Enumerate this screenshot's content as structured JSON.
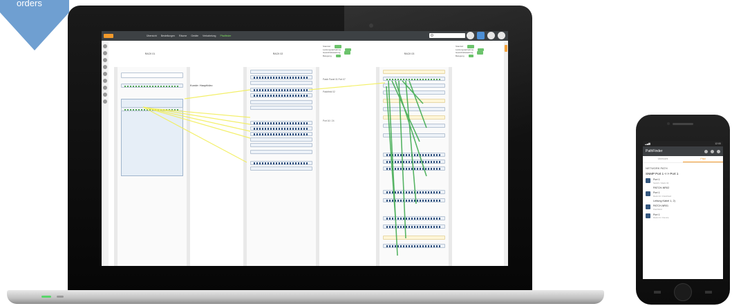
{
  "badge": {
    "label": "orders",
    "color": "#6f9fd1"
  },
  "app": {
    "menu": [
      "Übersicht",
      "Bestellungen",
      "Räume",
      "Geräte",
      "Verkabelung",
      "Pfadfinder"
    ],
    "search_placeholder": "Suchen",
    "racks": [
      {
        "title": "RACK 01"
      },
      {
        "title": "RACK 02"
      },
      {
        "title": "RACK 03"
      }
    ],
    "info_labels": [
      "Standort",
      "Leistungsaufnahme",
      "Gewichtsbelastung",
      "Belegung"
    ],
    "labels": {
      "patch_main": "Kunde: Hauptbüro",
      "notes": [
        "Patch Panel 01 Port 07",
        "Patchfeld 02",
        "Port 16 / 24"
      ]
    }
  },
  "phone": {
    "status_time": "12:00",
    "app_title": "PathFinder",
    "tabs": [
      "Übersicht",
      "Pfad"
    ],
    "section": "NETWORK PATH",
    "path_title": "SNMP Port 1 <-> Port 1",
    "entries": [
      {
        "title": "Port 1",
        "sub": "Switch / Rack 03"
      },
      {
        "title": "PATCH-NR02",
        "sub": "Patchfeld"
      },
      {
        "title": "Port 1",
        "sub": "Rack 02 / Patchfeld"
      },
      {
        "title": "PATCH-NR01",
        "sub": "Patchfeld"
      },
      {
        "title": "Port 1",
        "sub": "Rack 01 / Device"
      }
    ],
    "cable_label": "Leitung Kabel 1, 2)"
  },
  "colors": {
    "accent": "#f39a2b",
    "cable": "#f2ee5a",
    "cable_green": "#3aa84a",
    "topbar": "#3d4144"
  }
}
